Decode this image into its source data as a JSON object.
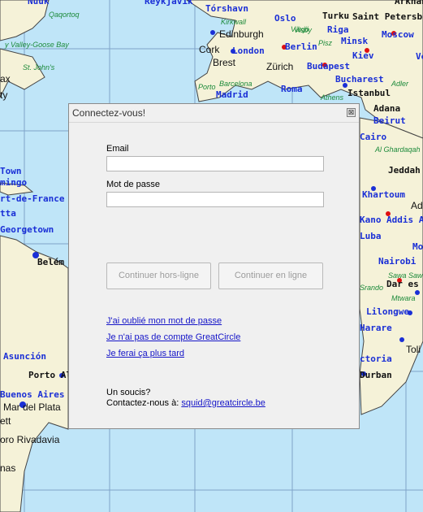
{
  "map": {
    "labels_blue": [
      "Nuuk",
      "Reykjavík",
      "Tórshavn",
      "Oslo",
      "Turku",
      "Saint Petersburg",
      "Edinburgh",
      "Riga",
      "Moscow",
      "Cork",
      "London",
      "Berlin",
      "Minsk",
      "Kiev",
      "Budapest",
      "Bucharest",
      "Madrid",
      "Roma",
      "Istanbul",
      "Adana",
      "Beirut",
      "Cairo",
      "Town",
      "mingo",
      "rt-de-France",
      "Georgetown",
      "Khartoum",
      "Addis A",
      "Nairobi",
      "Dar es",
      "Lilongwe",
      "Harare",
      "ctoria",
      "Durban",
      "Asunción",
      "Buenos Aires",
      "Jeddah",
      "Mo",
      "Luba",
      "Kano",
      "Vo",
      "tta"
    ],
    "labels_black": [
      "Brest",
      "Zürich",
      "Belém",
      "Porto Al",
      "Mar del Plata",
      "ett",
      "oro Rivadavia",
      "nas",
      "ax",
      "ty",
      "Ad",
      "Toli",
      "Arkhan"
    ],
    "labels_green": [
      "Qaqortoq",
      "y Valley-Goose Bay",
      "St. John's",
      "Kirkwall",
      "Visby",
      "Pisz",
      "Porto",
      "Barcelona",
      "Athens",
      "Adler",
      "Al Ghardaqah",
      "Sawa Sawa",
      "Mtwara",
      "Srando",
      "Växjö"
    ]
  },
  "dialog": {
    "title": "Connectez-vous!",
    "close_glyph": "⊠",
    "email_label": "Email",
    "email_value": "",
    "password_label": "Mot de passe",
    "password_value": "",
    "offline_button": "Continuer hors-ligne",
    "online_button": "Continuer en ligne",
    "forgot_link": "J'ai oublié mon mot de passe",
    "no_account_link": "Je n'ai pas de compte GreatCircle",
    "later_link": "Je ferai ça plus tard",
    "issue_text": "Un soucis?",
    "contact_prefix": "Contactez-nous à:",
    "contact_email": "squid@greatcircle.be"
  }
}
